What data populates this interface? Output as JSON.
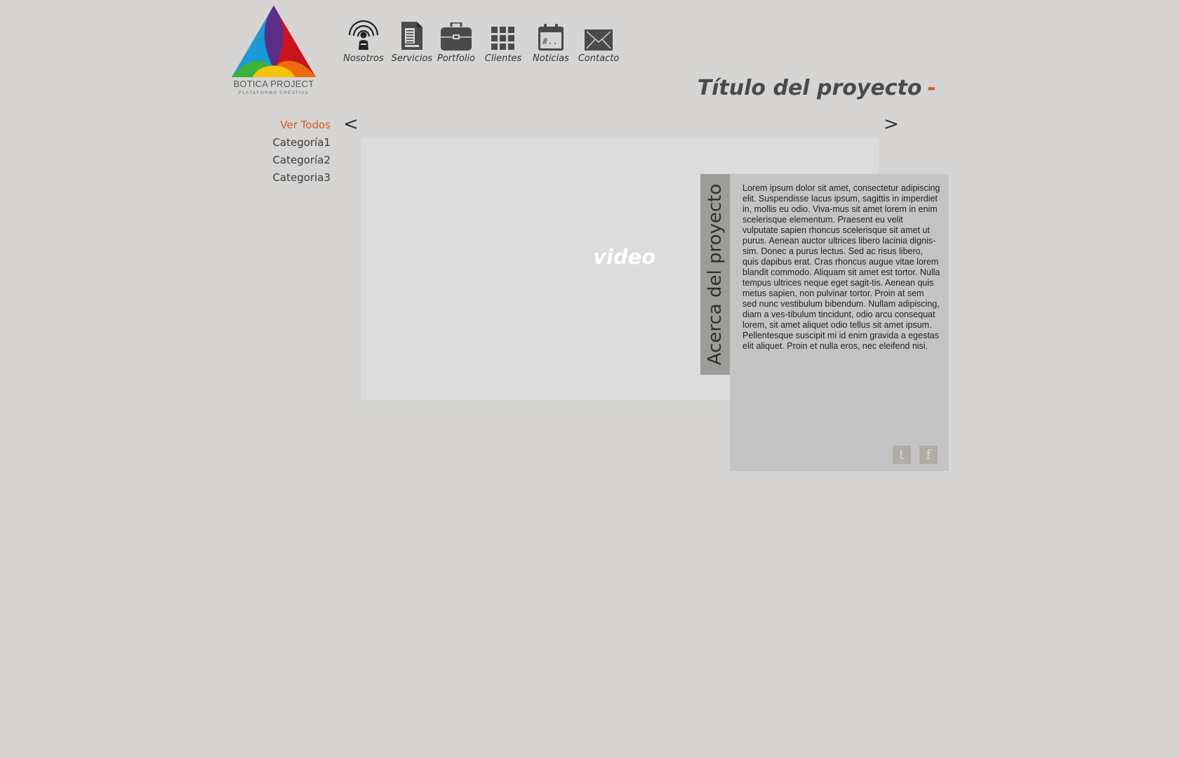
{
  "logo": {
    "title": "BOTICA PROJECT",
    "subtitle": "PLATAFORMA CREATIVA",
    "colors": [
      "#1a9ad6",
      "#c8141e",
      "#5b2d87",
      "#3cb23a",
      "#f8c20a",
      "#ef6c0e"
    ]
  },
  "nav": {
    "items": [
      {
        "label": "Nosotros",
        "icon": "person-broadcast-icon"
      },
      {
        "label": "Servicios",
        "icon": "document-icon"
      },
      {
        "label": "Portfolio",
        "icon": "briefcase-icon"
      },
      {
        "label": "Clientes",
        "icon": "grid-icon"
      },
      {
        "label": "Noticias",
        "icon": "calendar-icon"
      },
      {
        "label": "Contacto",
        "icon": "envelope-icon"
      }
    ]
  },
  "project": {
    "title": "Título del proyecto",
    "title_dash": "-"
  },
  "categories": [
    {
      "label": "Ver Todos",
      "active": true
    },
    {
      "label": "Categoría1",
      "active": false
    },
    {
      "label": "Categoría2",
      "active": false
    },
    {
      "label": "Categoria3",
      "active": false
    }
  ],
  "carousel": {
    "prev": "<",
    "next": ">"
  },
  "video": {
    "label": "video"
  },
  "about": {
    "heading": "Acerca del proyecto",
    "body": "Lorem ipsum dolor sit amet, consectetur adipiscing elit. Suspendisse lacus ipsum, sagittis in imperdiet in, mollis eu odio. Viva-mus sit amet lorem in enim scelerisque elementum. Praesent eu velit vulputate sapien rhoncus scelerisque sit amet ut purus. Aenean auctor ultrices libero lacinia dignis-sim. Donec a purus lectus. Sed ac risus libero, quis dapibus erat. Cras rhoncus augue vitae lorem blandit commodo. Aliquam sit amet est tortor. Nulla tempus ultrices neque eget sagit-tis. Aenean quis metus sapien, non pulvinar tortor. Proin at sem sed nunc vestibulum bibendum. Nullam adipiscing, diam a ves-tibulum tincidunt, odio arcu consequat lorem, sit amet aliquet odio tellus sit amet ipsum. Pellentesque suscipit mi id enim gravida a egestas elit aliquet. Proin et nulla eros, nec eleifend nisi."
  },
  "social": {
    "twitter": "t",
    "facebook": "f"
  },
  "colors": {
    "accent": "#e0561c",
    "background": "#d6d5d3",
    "icon": "#4a4a4a"
  }
}
